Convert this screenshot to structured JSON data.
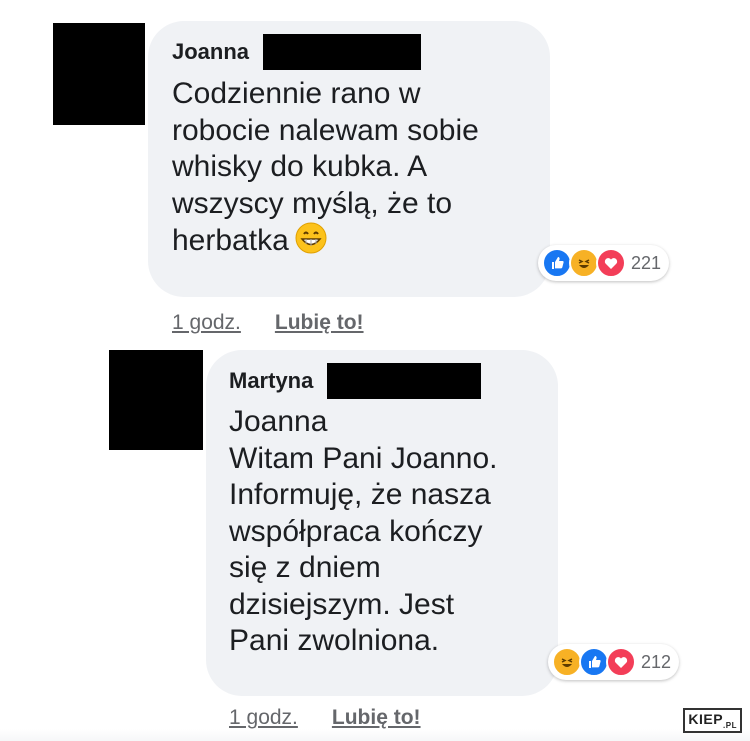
{
  "comment1": {
    "author": "Joanna",
    "lines": [
      "Codziennie rano w",
      "robocie nalewam sobie",
      "whisky do kubka. A",
      "wszyscy myślą, że to",
      "herbatka"
    ],
    "inline_emoji": "grinning-face-icon",
    "reaction_icons": [
      "like-icon",
      "haha-icon",
      "love-icon"
    ],
    "reaction_count": "221",
    "time": "1 godz.",
    "like_label": "Lubię to!"
  },
  "comment2": {
    "author": "Martyna",
    "lines": [
      "Joanna",
      "Witam Pani Joanno.",
      "Informuję, że nasza",
      "współpraca kończy",
      "się z dniem",
      "dzisiejszym. Jest",
      "Pani zwolniona."
    ],
    "reaction_icons": [
      "haha-icon",
      "like-icon",
      "love-icon"
    ],
    "reaction_count": "212",
    "time": "1 godz.",
    "like_label": "Lubię to!"
  },
  "watermark": {
    "text": "KIEP",
    "suffix": ".PL"
  },
  "colors": {
    "bubble": "#f0f2f5",
    "like_blue": "#1877f2",
    "love_red": "#f33e58",
    "haha_yellow": "#f7b125",
    "meta_gray": "#65676b"
  }
}
